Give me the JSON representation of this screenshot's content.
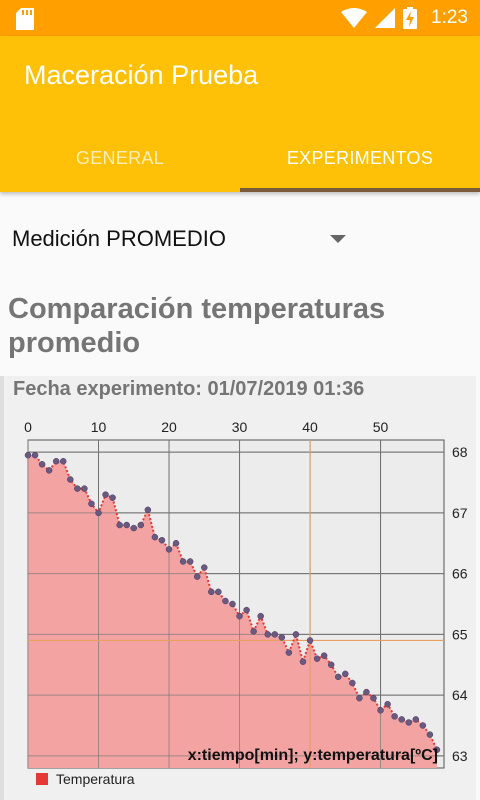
{
  "status_bar": {
    "time": "1:23",
    "icons": [
      "sd-card-icon",
      "wifi-icon",
      "signal-icon",
      "battery-charging-icon"
    ]
  },
  "app_bar": {
    "title": "Maceración Prueba",
    "tabs": [
      {
        "label": "GENERAL",
        "selected": false
      },
      {
        "label": "EXPERIMENTOS",
        "selected": true
      }
    ],
    "colors": {
      "primary": "#ffc107",
      "status": "#ffa000",
      "indicator": "#7b5a3c"
    }
  },
  "spinner": {
    "selected": "Medición PROMEDIO"
  },
  "section": {
    "title": "Comparación temperaturas promedio"
  },
  "chart_data": {
    "type": "area",
    "title": "Fecha experimento: 01/07/2019 01:36",
    "axis_note": "x:tiempo[min]; y:temperatura[ºC]",
    "x_ticks": [
      0,
      10,
      20,
      30,
      40,
      50
    ],
    "y_ticks": [
      63,
      64,
      65,
      66,
      67,
      68
    ],
    "xlim": [
      0,
      59
    ],
    "ylim": [
      62.8,
      68.2
    ],
    "grid": true,
    "legend_position": "bottom-left",
    "crosshair": {
      "x": 40,
      "y": 64.9
    },
    "series": [
      {
        "name": "Temperatura",
        "color": "#e53935",
        "fill": "#f4a3a3",
        "x": [
          0,
          1,
          2,
          3,
          4,
          5,
          6,
          7,
          8,
          9,
          10,
          11,
          12,
          13,
          14,
          15,
          16,
          17,
          18,
          19,
          20,
          21,
          22,
          23,
          24,
          25,
          26,
          27,
          28,
          29,
          30,
          31,
          32,
          33,
          34,
          35,
          36,
          37,
          38,
          39,
          40,
          41,
          42,
          43,
          44,
          45,
          46,
          47,
          48,
          49,
          50,
          51,
          52,
          53,
          54,
          55,
          56,
          57,
          58
        ],
        "values": [
          67.95,
          67.95,
          67.8,
          67.7,
          67.85,
          67.85,
          67.55,
          67.4,
          67.4,
          67.15,
          67.0,
          67.3,
          67.25,
          66.8,
          66.8,
          66.75,
          66.8,
          67.05,
          66.6,
          66.55,
          66.4,
          66.5,
          66.2,
          66.2,
          65.95,
          66.1,
          65.7,
          65.7,
          65.55,
          65.5,
          65.3,
          65.4,
          65.05,
          65.3,
          65.0,
          65.0,
          64.95,
          64.7,
          65.0,
          64.55,
          64.9,
          64.6,
          64.65,
          64.5,
          64.3,
          64.35,
          64.2,
          63.95,
          64.05,
          63.95,
          63.75,
          63.85,
          63.65,
          63.6,
          63.55,
          63.6,
          63.5,
          63.35,
          63.1
        ]
      }
    ]
  }
}
